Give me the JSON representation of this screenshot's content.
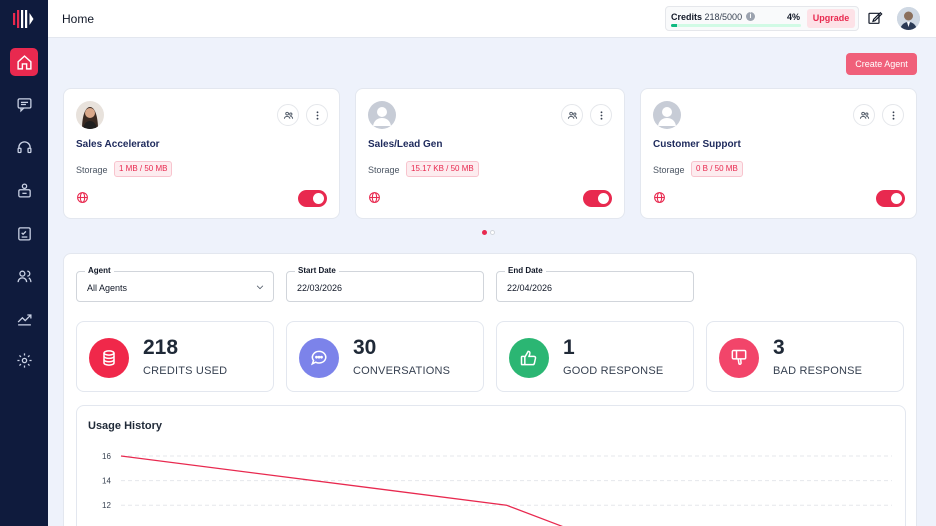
{
  "header": {
    "title": "Home",
    "credits_label": "Credits",
    "credits_value": "218/5000",
    "credits_percent_text": "4%",
    "credits_fraction": 0.0436,
    "upgrade_label": "Upgrade"
  },
  "sidebar": {
    "items": [
      {
        "icon": "home-icon",
        "active": true
      },
      {
        "icon": "chat-icon",
        "active": false
      },
      {
        "icon": "headset-icon",
        "active": false
      },
      {
        "icon": "agent-icon",
        "active": false
      },
      {
        "icon": "checklist-icon",
        "active": false
      },
      {
        "icon": "users-icon",
        "active": false
      },
      {
        "icon": "analytics-icon",
        "active": false
      },
      {
        "icon": "settings-icon",
        "active": false
      }
    ]
  },
  "create_agent_label": "Create Agent",
  "agents": [
    {
      "name": "Sales Accelerator",
      "storage_label": "Storage",
      "storage": "1 MB / 50 MB",
      "enabled": true
    },
    {
      "name": "Sales/Lead Gen",
      "storage_label": "Storage",
      "storage": "15.17 KB / 50 MB",
      "enabled": true
    },
    {
      "name": "Customer Support",
      "storage_label": "Storage",
      "storage": "0 B / 50 MB",
      "enabled": true
    }
  ],
  "filters": {
    "agent": {
      "label": "Agent",
      "value": "All Agents"
    },
    "start": {
      "label": "Start Date",
      "value": "22/03/2026"
    },
    "end": {
      "label": "End Date",
      "value": "22/04/2026"
    }
  },
  "stats": [
    {
      "value": "218",
      "label": "CREDITS USED",
      "color": "#f0284a",
      "icon": "coins-icon"
    },
    {
      "value": "30",
      "label": "CONVERSATIONS",
      "color": "#7c83ea",
      "icon": "conversation-icon"
    },
    {
      "value": "1",
      "label": "GOOD RESPONSE",
      "color": "#2bb673",
      "icon": "thumbs-up-icon"
    },
    {
      "value": "3",
      "label": "BAD RESPONSE",
      "color": "#f2456a",
      "icon": "thumbs-down-icon"
    }
  ],
  "usage": {
    "title": "Usage History"
  },
  "chart_data": {
    "type": "line",
    "title": "Usage History",
    "y_ticks": [
      16,
      14,
      12
    ],
    "ylim": [
      10,
      16
    ],
    "series": [
      {
        "color": "#e8294f",
        "values": [
          16,
          12,
          10
        ]
      }
    ],
    "x_fraction_points": [
      0,
      0.5,
      0.584
    ],
    "grid": true
  }
}
